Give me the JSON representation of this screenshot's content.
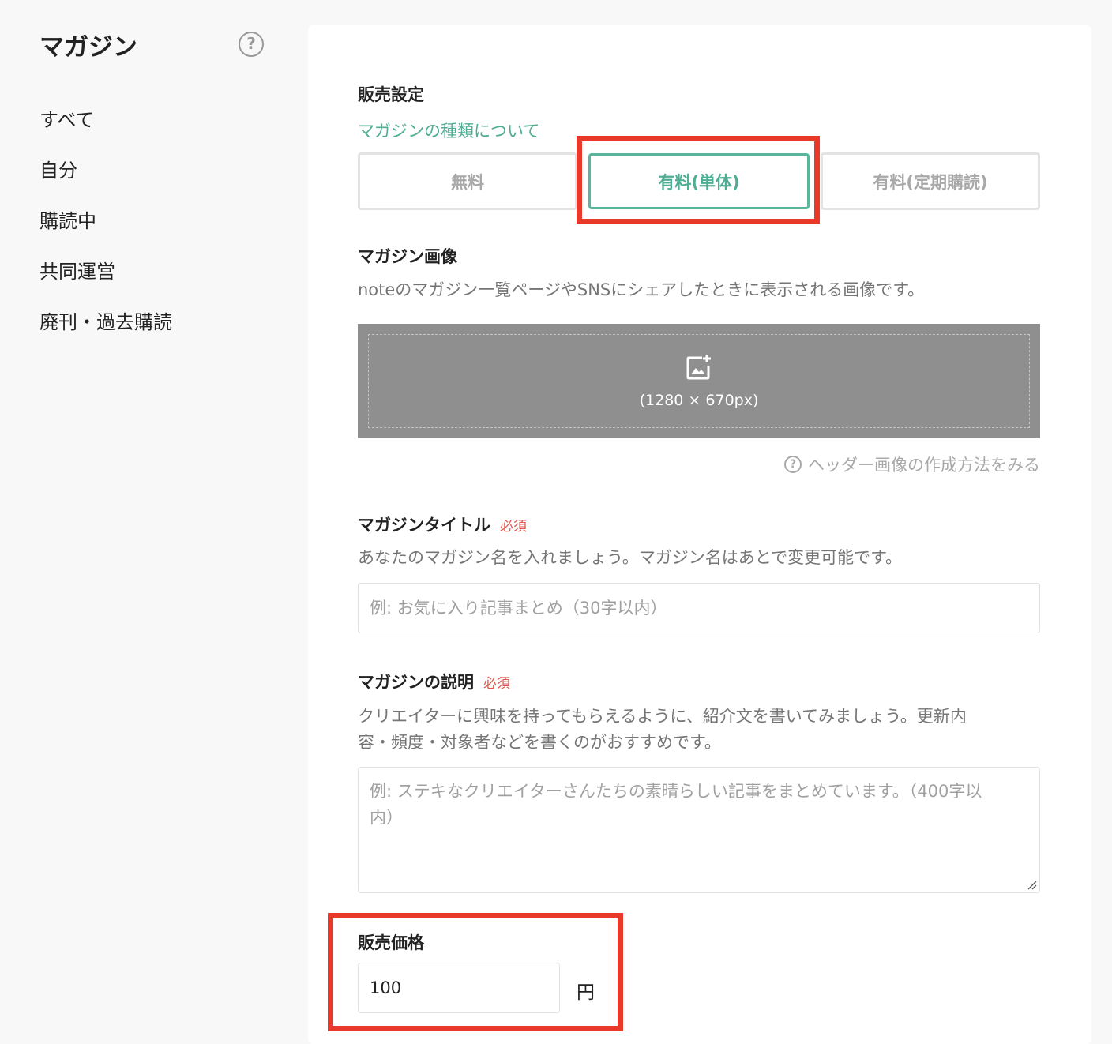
{
  "sidebar": {
    "title": "マガジン",
    "help_glyph": "?",
    "items": [
      {
        "label": "すべて"
      },
      {
        "label": "自分"
      },
      {
        "label": "購読中"
      },
      {
        "label": "共同運営"
      },
      {
        "label": "廃刊・過去購読"
      }
    ]
  },
  "sales": {
    "title": "販売設定",
    "type_link": "マガジンの種類について",
    "tabs": [
      {
        "label": "無料",
        "selected": false
      },
      {
        "label": "有料(単体)",
        "selected": true
      },
      {
        "label": "有料(定期購読)",
        "selected": false
      }
    ]
  },
  "image": {
    "title": "マガジン画像",
    "description": "noteのマガジン一覧ページやSNSにシェアしたときに表示される画像です。",
    "size_hint": "(1280 × 670px)",
    "icon": "add-image-icon",
    "howto_glyph": "?",
    "howto_link": "ヘッダー画像の作成方法をみる"
  },
  "magazine_title": {
    "title": "マガジンタイトル",
    "required": "必須",
    "description": "あなたのマガジン名を入れましょう。マガジン名はあとで変更可能です。",
    "placeholder": "例: お気に入り記事まとめ（30字以内）"
  },
  "magazine_desc": {
    "title": "マガジンの説明",
    "required": "必須",
    "description_line1": "クリエイターに興味を持ってもらえるように、紹介文を書いてみましょう。更新内",
    "description_line2": "容・頻度・対象者などを書くのがおすすめです。",
    "placeholder_line1": "例: ステキなクリエイターさんたちの素晴らしい記事をまとめています。（400字以",
    "placeholder_line2": "内）"
  },
  "price": {
    "title": "販売価格",
    "value": "100",
    "unit": "円"
  },
  "colors": {
    "accent": "#4fad93",
    "highlight": "#e8392a",
    "required": "#e0574f"
  }
}
